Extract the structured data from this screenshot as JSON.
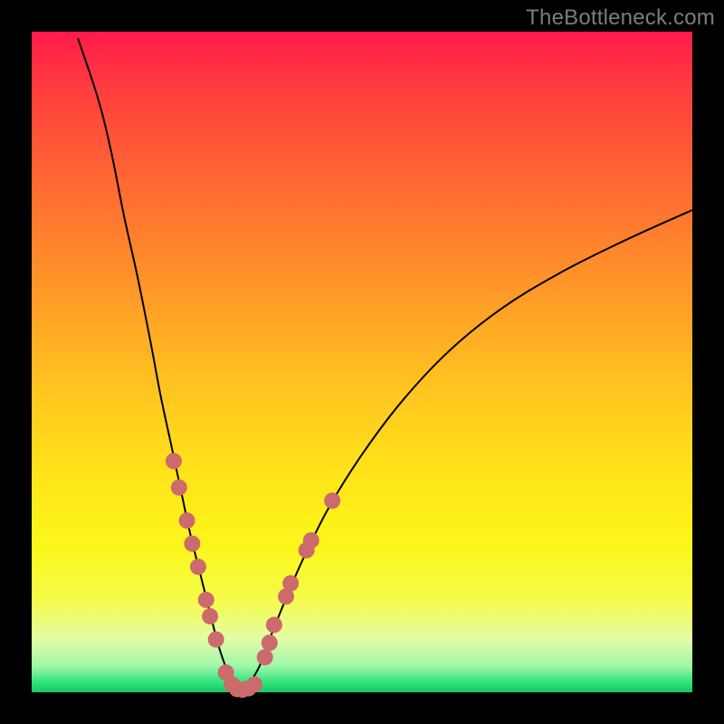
{
  "watermark": "TheBottleneck.com",
  "chart_data": {
    "type": "line",
    "title": "",
    "xlabel": "",
    "ylabel": "",
    "xlim": [
      0,
      100
    ],
    "ylim": [
      0,
      100
    ],
    "background_gradient": {
      "top": "#ff1a4b",
      "bottom": "#16c765",
      "meaning": "red (high bottleneck) to green (low bottleneck)"
    },
    "series": [
      {
        "name": "bottleneck-curve-left",
        "x": [
          7,
          10,
          12,
          14,
          16,
          18,
          19.5,
          21,
          22.5,
          24,
          25.5,
          27,
          28.3,
          29.5,
          30.5,
          31.5
        ],
        "y": [
          99,
          90,
          82,
          72,
          63,
          53,
          45,
          38,
          31,
          24,
          18,
          12,
          7,
          3.5,
          1.2,
          0.2
        ]
      },
      {
        "name": "bottleneck-curve-right",
        "x": [
          31.5,
          33,
          34.5,
          36,
          38,
          41,
          45,
          50,
          56,
          63,
          71,
          80,
          90,
          100
        ],
        "y": [
          0.2,
          1.5,
          4,
          8,
          13,
          20,
          28,
          36,
          44,
          51.5,
          58,
          63.5,
          68.5,
          73
        ]
      }
    ],
    "markers": {
      "name": "highlight-dots",
      "color": "#cc6a6c",
      "radius": 9,
      "points": [
        {
          "x": 21.5,
          "y": 35
        },
        {
          "x": 22.3,
          "y": 31
        },
        {
          "x": 23.5,
          "y": 26
        },
        {
          "x": 24.3,
          "y": 22.5
        },
        {
          "x": 25.2,
          "y": 19
        },
        {
          "x": 26.4,
          "y": 14
        },
        {
          "x": 27.0,
          "y": 11.5
        },
        {
          "x": 27.9,
          "y": 8
        },
        {
          "x": 29.4,
          "y": 3
        },
        {
          "x": 30.3,
          "y": 1.2
        },
        {
          "x": 31.1,
          "y": 0.5
        },
        {
          "x": 31.9,
          "y": 0.4
        },
        {
          "x": 32.8,
          "y": 0.6
        },
        {
          "x": 33.7,
          "y": 1.2
        },
        {
          "x": 35.3,
          "y": 5.3
        },
        {
          "x": 36.0,
          "y": 7.5
        },
        {
          "x": 36.7,
          "y": 10.2
        },
        {
          "x": 38.5,
          "y": 14.5
        },
        {
          "x": 39.2,
          "y": 16.5
        },
        {
          "x": 41.6,
          "y": 21.5
        },
        {
          "x": 42.3,
          "y": 23
        },
        {
          "x": 45.5,
          "y": 29
        }
      ]
    }
  }
}
